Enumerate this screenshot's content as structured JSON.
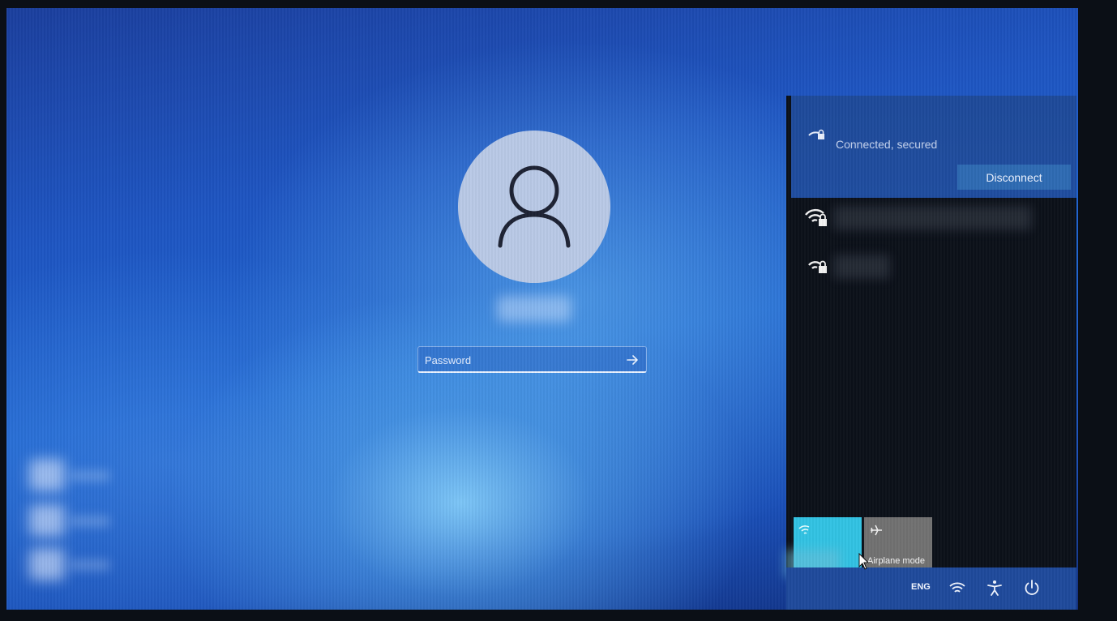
{
  "login": {
    "password_placeholder": "Password",
    "icons": {
      "avatar": "person-icon",
      "submit": "arrow-right-icon"
    }
  },
  "network_flyout": {
    "connection_status": "Connected, secured",
    "disconnect_label": "Disconnect",
    "networks": [
      {
        "icon": "wifi-secured-icon"
      },
      {
        "icon": "wifi-secured-weak-icon"
      }
    ],
    "quick_actions": [
      {
        "icon": "wifi-icon",
        "label": "",
        "active": true,
        "color": "#32c3e3"
      },
      {
        "icon": "airplane-icon",
        "label": "Airplane mode",
        "active": false,
        "color": "#717171"
      }
    ]
  },
  "taskbar": {
    "language": "ENG",
    "icons": [
      "wifi-icon",
      "accessibility-icon",
      "power-icon"
    ]
  }
}
